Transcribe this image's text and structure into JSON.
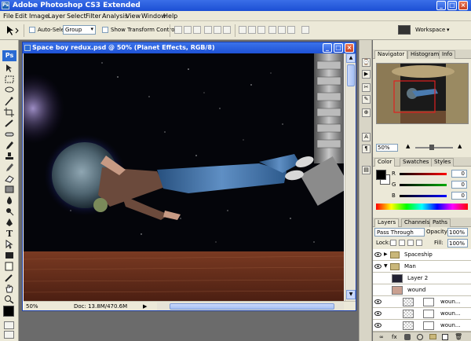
{
  "app": {
    "title": "Adobe Photoshop CS3 Extended"
  },
  "menu": [
    "File",
    "Edit",
    "Image",
    "Layer",
    "Select",
    "Filter",
    "Analysis",
    "View",
    "Window",
    "Help"
  ],
  "options": {
    "auto_select_label": "Auto-Select:",
    "auto_select_value": "Group",
    "show_transform_label": "Show Transform Controls",
    "workspace_label": "Workspace"
  },
  "document": {
    "title": "Space boy redux.psd @ 50% (Planet Effects, RGB/8)",
    "zoom": "50%",
    "doc_info": "Doc: 13.8M/470.6M"
  },
  "tools": {
    "logo": "Ps"
  },
  "navigator": {
    "tabs": [
      "Navigator",
      "Histogram",
      "Info"
    ],
    "zoom": "50%"
  },
  "color": {
    "tabs": [
      "Color",
      "Swatches",
      "Styles"
    ],
    "channels": [
      {
        "label": "R",
        "value": "0"
      },
      {
        "label": "G",
        "value": "0"
      },
      {
        "label": "B",
        "value": "0"
      }
    ],
    "fg_color": "#000000",
    "bg_color": "#ffffff"
  },
  "layers": {
    "tabs": [
      "Layers",
      "Channels",
      "Paths"
    ],
    "blend_mode": "Pass Through",
    "opacity_label": "Opacity:",
    "opacity": "100%",
    "lock_label": "Lock:",
    "fill_label": "Fill:",
    "fill": "100%",
    "items": [
      {
        "name": "Spaceship",
        "type": "group"
      },
      {
        "name": "Man",
        "type": "group"
      },
      {
        "name": "Layer 2",
        "type": "layer"
      },
      {
        "name": "wound",
        "type": "layer"
      },
      {
        "name": "woun...",
        "type": "mask"
      },
      {
        "name": "woun...",
        "type": "mask"
      },
      {
        "name": "woun...",
        "type": "mask"
      }
    ]
  }
}
